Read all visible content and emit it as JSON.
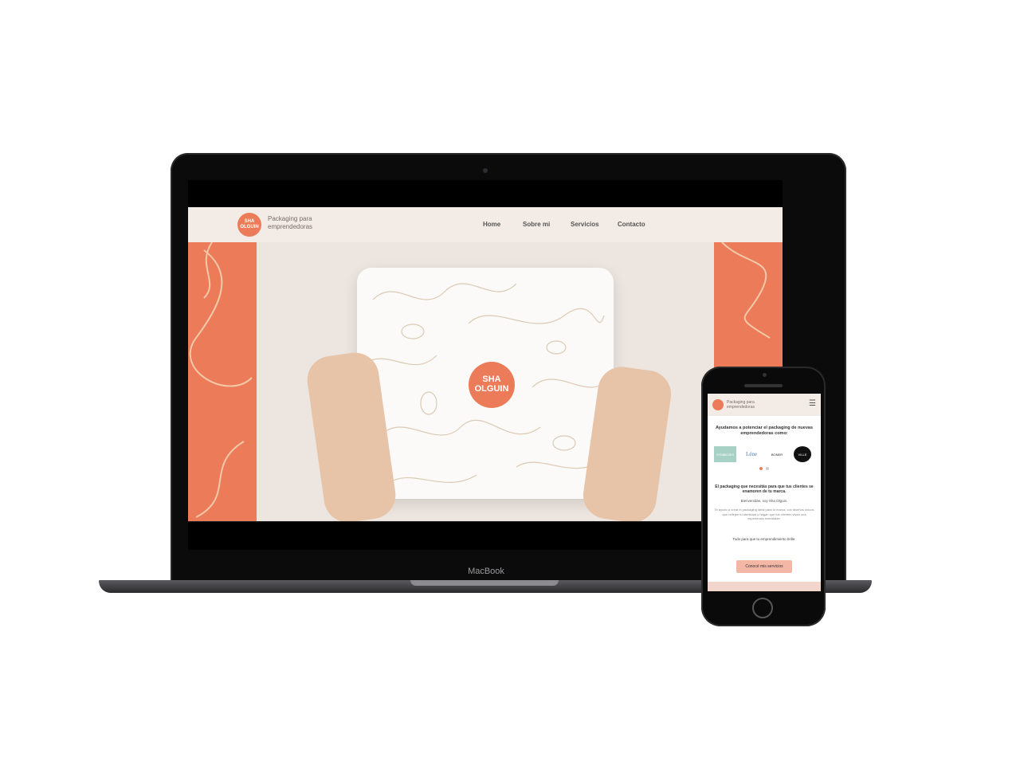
{
  "colors": {
    "accent": "#ec7c59",
    "header_bg": "#f3ece6",
    "hero_bg": "#ede5df"
  },
  "laptop": {
    "brand": "MacBook",
    "site": {
      "logo_text": "SHA OLGUIN",
      "tagline": "Packaging para emprendedoras",
      "nav": [
        "Home",
        "Sobre mi",
        "Servicios",
        "Contacto"
      ],
      "package_logo_text": "SHA OLGUIN"
    }
  },
  "phone": {
    "tagline": "Packaging para emprendedoras",
    "headline": "Ayudamos a potenciar el packaging de nuevas emprendedoras como:",
    "brands": [
      "SYMBIOSIS",
      "Léne",
      "BONER",
      "VILLE"
    ],
    "subheadline": "El packaging que necesitás para que tus clientes se enamoren de tu marca.",
    "greeting": "Bienvenidas, soy Sha Olguin.",
    "body": "Te ayudo a crear el packaging ideal para tu marca, con diseños únicos que reflejen tu identidad y hagan que tus clientes vivan una experiencia inolvidable.",
    "tagline2": "Todo para que tu emprendimiento brille.",
    "cta": "Conocé mis servicios"
  }
}
